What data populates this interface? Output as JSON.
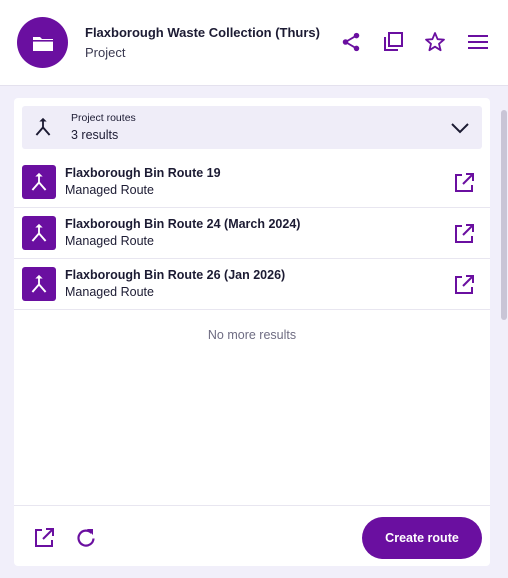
{
  "header": {
    "title": "Flaxborough Waste Collection (Thurs)",
    "subtitle": "Project",
    "avatar_icon": "folder-icon",
    "actions": [
      "share-icon",
      "copy-icon",
      "star-icon",
      "menu-icon"
    ]
  },
  "group": {
    "label": "Project routes",
    "count": "3 results",
    "icon": "merge-icon",
    "toggle_icon": "chevron-down-icon"
  },
  "routes": [
    {
      "title": "Flaxborough Bin Route 19",
      "subtitle": "Managed Route"
    },
    {
      "title": "Flaxborough Bin Route 24 (March 2024)",
      "subtitle": "Managed Route"
    },
    {
      "title": "Flaxborough Bin Route 26 (Jan 2026)",
      "subtitle": "Managed Route"
    }
  ],
  "no_more": "No more results",
  "footer": {
    "create_label": "Create route",
    "icons": [
      "open-external-icon",
      "refresh-icon"
    ]
  },
  "colors": {
    "accent": "#6a0fa0",
    "background": "#f1effa",
    "text": "#1c1b33"
  }
}
